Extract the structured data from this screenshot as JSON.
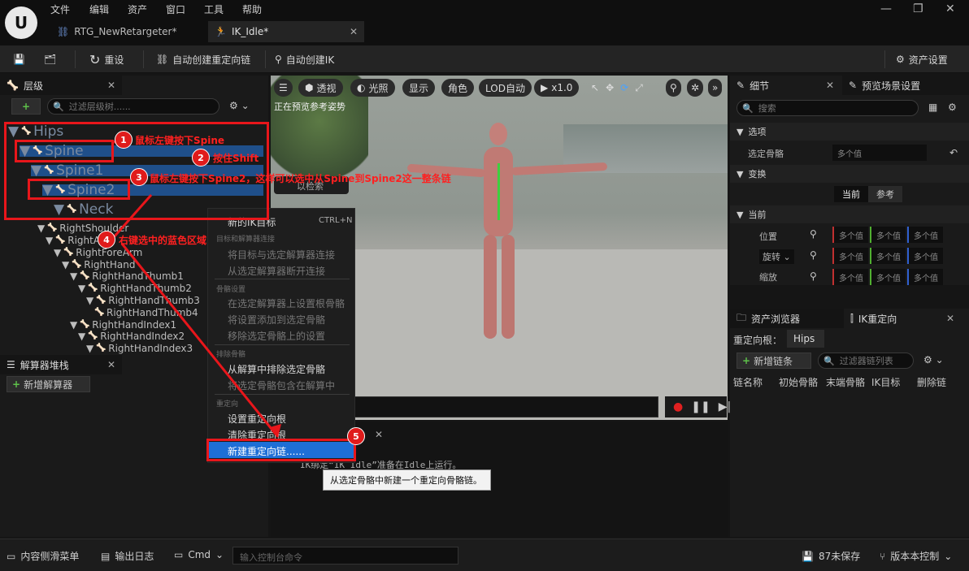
{
  "app": {
    "logo": "U",
    "menu": [
      "文件",
      "编辑",
      "资产",
      "窗口",
      "工具",
      "帮助"
    ],
    "window_controls": [
      "—",
      "❐",
      "✕"
    ]
  },
  "tabs": [
    {
      "label": "RTG_NewRetargeter*"
    },
    {
      "label": "IK_Idle*"
    }
  ],
  "toolbar": {
    "reset": "重设",
    "auto_chain": "自动创建重定向链",
    "auto_ik": "自动创建IK",
    "asset_settings": "资产设置"
  },
  "hierarchy": {
    "title": "层级",
    "search_placeholder": "过滤层级树......",
    "bones": [
      "Hips",
      "Spine",
      "Spine1",
      "Spine2",
      "Neck",
      "RightShoulder",
      "RightArm",
      "RightForeArm",
      "RightHand",
      "RightHandThumb1",
      "RightHandThumb2",
      "RightHandThumb3",
      "RightHandThumb4",
      "RightHandIndex1",
      "RightHandIndex2",
      "RightHandIndex3"
    ]
  },
  "solver_stack": {
    "title": "解算器堆栈",
    "add": "新增解算器"
  },
  "viewport": {
    "buttons": [
      "透视",
      "光照",
      "显示",
      "角色",
      "LOD自动",
      "x1.0"
    ],
    "preview_text": "正在预览参考姿势",
    "hidden_label": "以检索"
  },
  "context_menu": {
    "first_item": "新的IK目标",
    "first_shortcut": "CTRL+N",
    "sec1": "目标和解算器连接",
    "sec1_items": [
      "将目标与选定解算器连接",
      "从选定解算器断开连接"
    ],
    "sec2": "骨骼设置",
    "sec2_items": [
      "在选定解算器上设置根骨骼",
      "将设置添加到选定骨骼",
      "移除选定骨骼上的设置"
    ],
    "sec3": "排除骨骼",
    "sec3_items": [
      "从解算中排除选定骨骼",
      "将选定骨骼包含在解算中"
    ],
    "sec4": "重定向",
    "sec4_items": [
      "设置重定向根",
      "清除重定向根",
      "新建重定向链......"
    ]
  },
  "tooltip": "从选定骨骼中新建一个重定向骨骼链。",
  "output_log_line": "IK绑定“IK_Idle”准备在Idle上运行。",
  "details": {
    "tab": "细节",
    "tab2": "预览场景设置",
    "search_placeholder": "搜索",
    "sec_options": "选项",
    "selected_bone_label": "选定骨骼",
    "selected_bone_value": "多个值",
    "sec_transform": "变换",
    "current": "当前",
    "reference": "参考",
    "sec_current": "当前",
    "rows": [
      {
        "label": "位置"
      },
      {
        "label": "旋转"
      },
      {
        "label": "缩放"
      }
    ],
    "multi": "多个值"
  },
  "retarget": {
    "tab_assets": "资产浏览器",
    "tab_ik": "IK重定向",
    "root_label": "重定向根：",
    "root_value": "Hips",
    "add_chain": "新增链条",
    "filter_placeholder": "过滤器链列表",
    "columns": [
      "链名称",
      "初始骨骼",
      "末端骨骼",
      "IK目标",
      "删除链"
    ]
  },
  "annotations": [
    {
      "num": "1",
      "text": "鼠标左键按下Spine"
    },
    {
      "num": "2",
      "text": "按住Shift"
    },
    {
      "num": "3",
      "text": "鼠标左键按下Spine2，这样可以选中从Spine到Spine2这一整条链"
    },
    {
      "num": "4",
      "text": "右键选中的蓝色区域"
    },
    {
      "num": "5",
      "text": ""
    }
  ],
  "statusbar": {
    "drawer": "内容侧滑菜单",
    "log": "输出日志",
    "cmd": "Cmd",
    "console_placeholder": "输入控制台命令",
    "unsaved": "87未保存",
    "source": "版本本控制"
  }
}
